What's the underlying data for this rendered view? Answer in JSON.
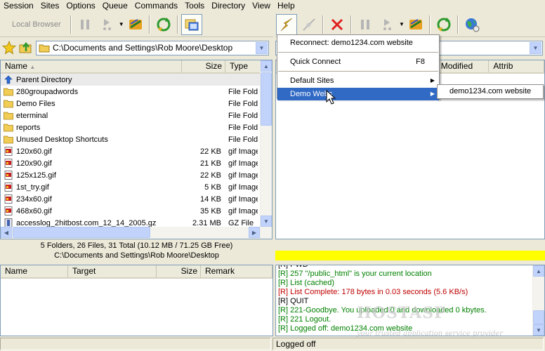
{
  "menubar": [
    "Session",
    "Sites",
    "Options",
    "Queue",
    "Commands",
    "Tools",
    "Directory",
    "View",
    "Help"
  ],
  "toolbar_left": {
    "local_browser_label": "Local Browser"
  },
  "local": {
    "path": "C:\\Documents and Settings\\Rob Moore\\Desktop",
    "columns": {
      "name": "Name",
      "size": "Size",
      "type": "Type"
    },
    "rows": [
      {
        "name": "Parent Directory",
        "size": "",
        "type": "",
        "icon": "up-arrow"
      },
      {
        "name": "280groupadwords",
        "size": "",
        "type": "File Folder",
        "icon": "folder"
      },
      {
        "name": "Demo Files",
        "size": "",
        "type": "File Folder",
        "icon": "folder"
      },
      {
        "name": "eterminal",
        "size": "",
        "type": "File Folder",
        "icon": "folder"
      },
      {
        "name": "reports",
        "size": "",
        "type": "File Folder",
        "icon": "folder"
      },
      {
        "name": "Unused Desktop Shortcuts",
        "size": "",
        "type": "File Folder",
        "icon": "folder"
      },
      {
        "name": "120x60.gif",
        "size": "22 KB",
        "type": "gif Image",
        "icon": "image"
      },
      {
        "name": "120x90.gif",
        "size": "21 KB",
        "type": "gif Image",
        "icon": "image"
      },
      {
        "name": "125x125.gif",
        "size": "22 KB",
        "type": "gif Image",
        "icon": "image"
      },
      {
        "name": "1st_try.gif",
        "size": "5 KB",
        "type": "gif Image",
        "icon": "image"
      },
      {
        "name": "234x60.gif",
        "size": "14 KB",
        "type": "gif Image",
        "icon": "image"
      },
      {
        "name": "468x60.gif",
        "size": "35 KB",
        "type": "gif Image",
        "icon": "image"
      },
      {
        "name": "accesslog_2hitbost.com_12_14_2005.gz",
        "size": "2.31 MB",
        "type": "GZ File",
        "icon": "archive"
      }
    ],
    "summary": "5 Folders, 26 Files, 31 Total (10.12 MB / 71.25 GB Free)",
    "path_status": "C:\\Documents and Settings\\Rob Moore\\Desktop"
  },
  "remote": {
    "columns": {
      "modified": "Modified",
      "attrib": "Attrib"
    }
  },
  "session_menu": {
    "reconnect": "Reconnect: demo1234.com website",
    "quick_connect": "Quick Connect",
    "quick_connect_shortcut": "F8",
    "default_sites": "Default Sites",
    "demo_webs": "Demo Webs"
  },
  "submenu": {
    "item": "demo1234.com website"
  },
  "queue": {
    "columns": {
      "name": "Name",
      "target": "Target",
      "size": "Size",
      "remark": "Remark"
    }
  },
  "log": [
    {
      "text": "[R] PWD",
      "color": "dark"
    },
    {
      "text": "[R] 257 \"/public_html\" is your current location",
      "color": "green"
    },
    {
      "text": "[R] List (cached)",
      "color": "green"
    },
    {
      "text": "[R] List Complete: 178 bytes in 0.03 seconds (5.6 KB/s)",
      "color": "red"
    },
    {
      "text": "[R] QUIT",
      "color": "dark"
    },
    {
      "text": "[R] 221-Goodbye. You uploaded 0 and downloaded 0 kbytes.",
      "color": "green"
    },
    {
      "text": "[R] 221 Logout.",
      "color": "green"
    },
    {
      "text": "[R] Logged off: demo1234.com website",
      "color": "green"
    }
  ],
  "watermark": {
    "title": "HOSTASP",
    "subtitle": "your trusted application service provider"
  },
  "status": {
    "right": "Logged off"
  },
  "colors": {
    "accent": "#316ac5",
    "transfer_bar": "#ffff00",
    "log_green": "#008000",
    "log_red": "#c00000"
  }
}
